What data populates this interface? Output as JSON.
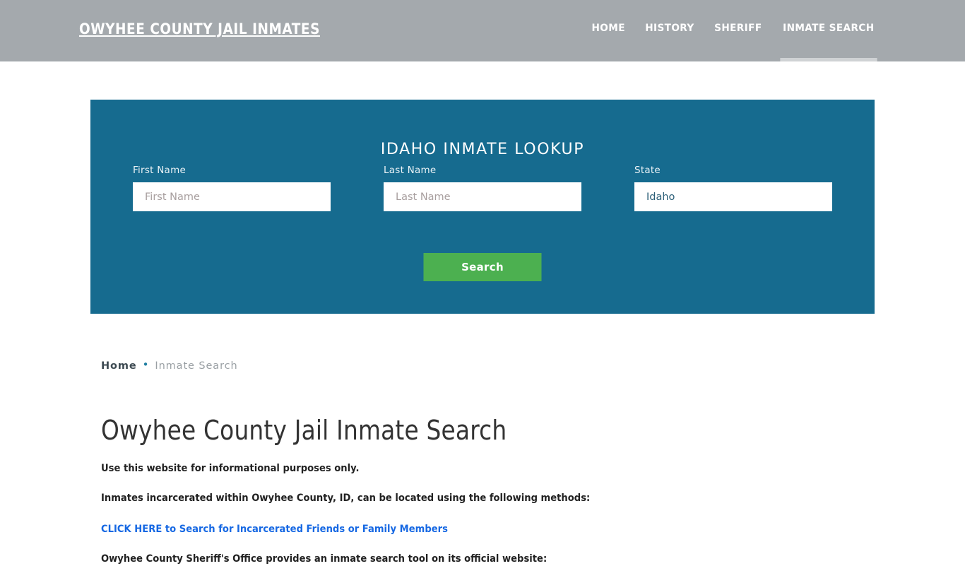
{
  "header": {
    "site_title": "OWYHEE COUNTY JAIL INMATES",
    "nav": [
      {
        "label": "HOME",
        "active": false
      },
      {
        "label": "HISTORY",
        "active": false
      },
      {
        "label": "SHERIFF",
        "active": false
      },
      {
        "label": "INMATE SEARCH",
        "active": true
      }
    ]
  },
  "lookup": {
    "title": "IDAHO INMATE LOOKUP",
    "first_name": {
      "label": "First Name",
      "placeholder": "First Name",
      "value": ""
    },
    "last_name": {
      "label": "Last Name",
      "placeholder": "Last Name",
      "value": ""
    },
    "state": {
      "label": "State",
      "selected": "Idaho"
    },
    "search_button": "Search",
    "colors": {
      "panel": "#166b8f",
      "button": "#4cb050",
      "header": "#a4a9ad",
      "link": "#1668e3"
    }
  },
  "breadcrumb": {
    "home": "Home",
    "separator": "•",
    "current": "Inmate Search"
  },
  "main": {
    "page_title": "Owyhee County Jail Inmate Search",
    "paragraph_1": "Use this website for informational purposes only.",
    "paragraph_2": "Inmates incarcerated within Owyhee County, ID, can be located using the following methods:",
    "link_1": "CLICK HERE to Search for Incarcerated Friends or Family Members",
    "paragraph_3": "Owyhee County Sheriff's Office provides an inmate search tool on its official website:"
  }
}
